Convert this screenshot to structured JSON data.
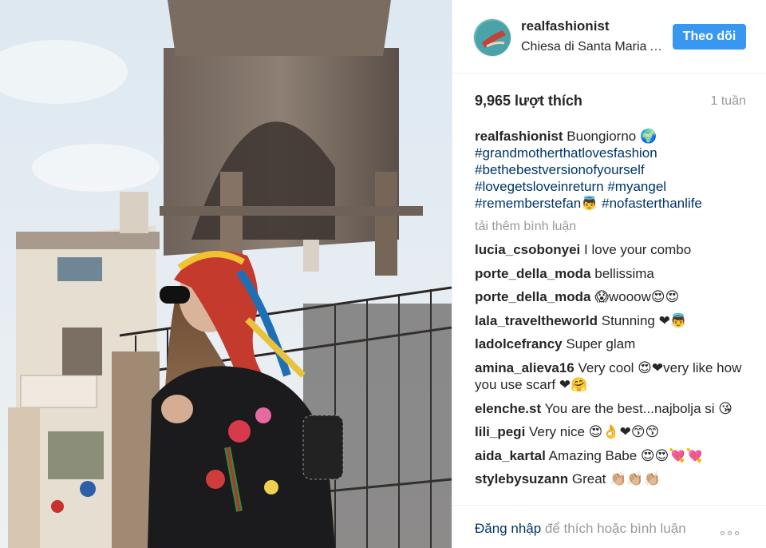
{
  "post": {
    "username": "realfashionist",
    "location": "Chiesa di Santa Maria Antica",
    "follow_label": "Theo dõi",
    "likes": "9,965 lượt thích",
    "age": "1 tuần",
    "caption": {
      "username": "realfashionist",
      "text": "Buongiorno 🌍",
      "hashtags": [
        "#grandmotherthatlovesfashion",
        "#bethebestversionofyourself",
        "#lovegetsloveinreturn",
        "#myangel",
        "#rememberstefan👼",
        "#nofasterthanlife"
      ]
    },
    "load_more": "tải thêm bình luận",
    "comments": [
      {
        "user": "lucia_csobonyei",
        "text": "I love your combo"
      },
      {
        "user": "porte_della_moda",
        "text": "bellissima"
      },
      {
        "user": "porte_della_moda",
        "text": "😱wooow😍😍"
      },
      {
        "user": "lala_traveltheworld",
        "text": "Stunning ❤👼"
      },
      {
        "user": "ladolcefrancy",
        "text": "Super glam"
      },
      {
        "user": "amina_alieva16",
        "text": "Very cool 😍❤very like how you use scarf ❤🤗"
      },
      {
        "user": "elenche.st",
        "text": "You are the best...najbolja si 😘"
      },
      {
        "user": "lili_pegi",
        "text": "Very nice 😍👌❤😙😙"
      },
      {
        "user": "aida_kartal",
        "text": "Amazing Babe 😍😍💘💘"
      },
      {
        "user": "stylebysuzann",
        "text": "Great 👏🏼👏🏼👏🏼"
      }
    ],
    "footer": {
      "login_link": "Đăng nhập",
      "login_rest": "để thích hoặc bình luận"
    }
  },
  "colors": {
    "accent": "#3897f0",
    "link": "#003569",
    "muted": "#999999"
  },
  "icons": {
    "more": "ellipsis-icon"
  }
}
